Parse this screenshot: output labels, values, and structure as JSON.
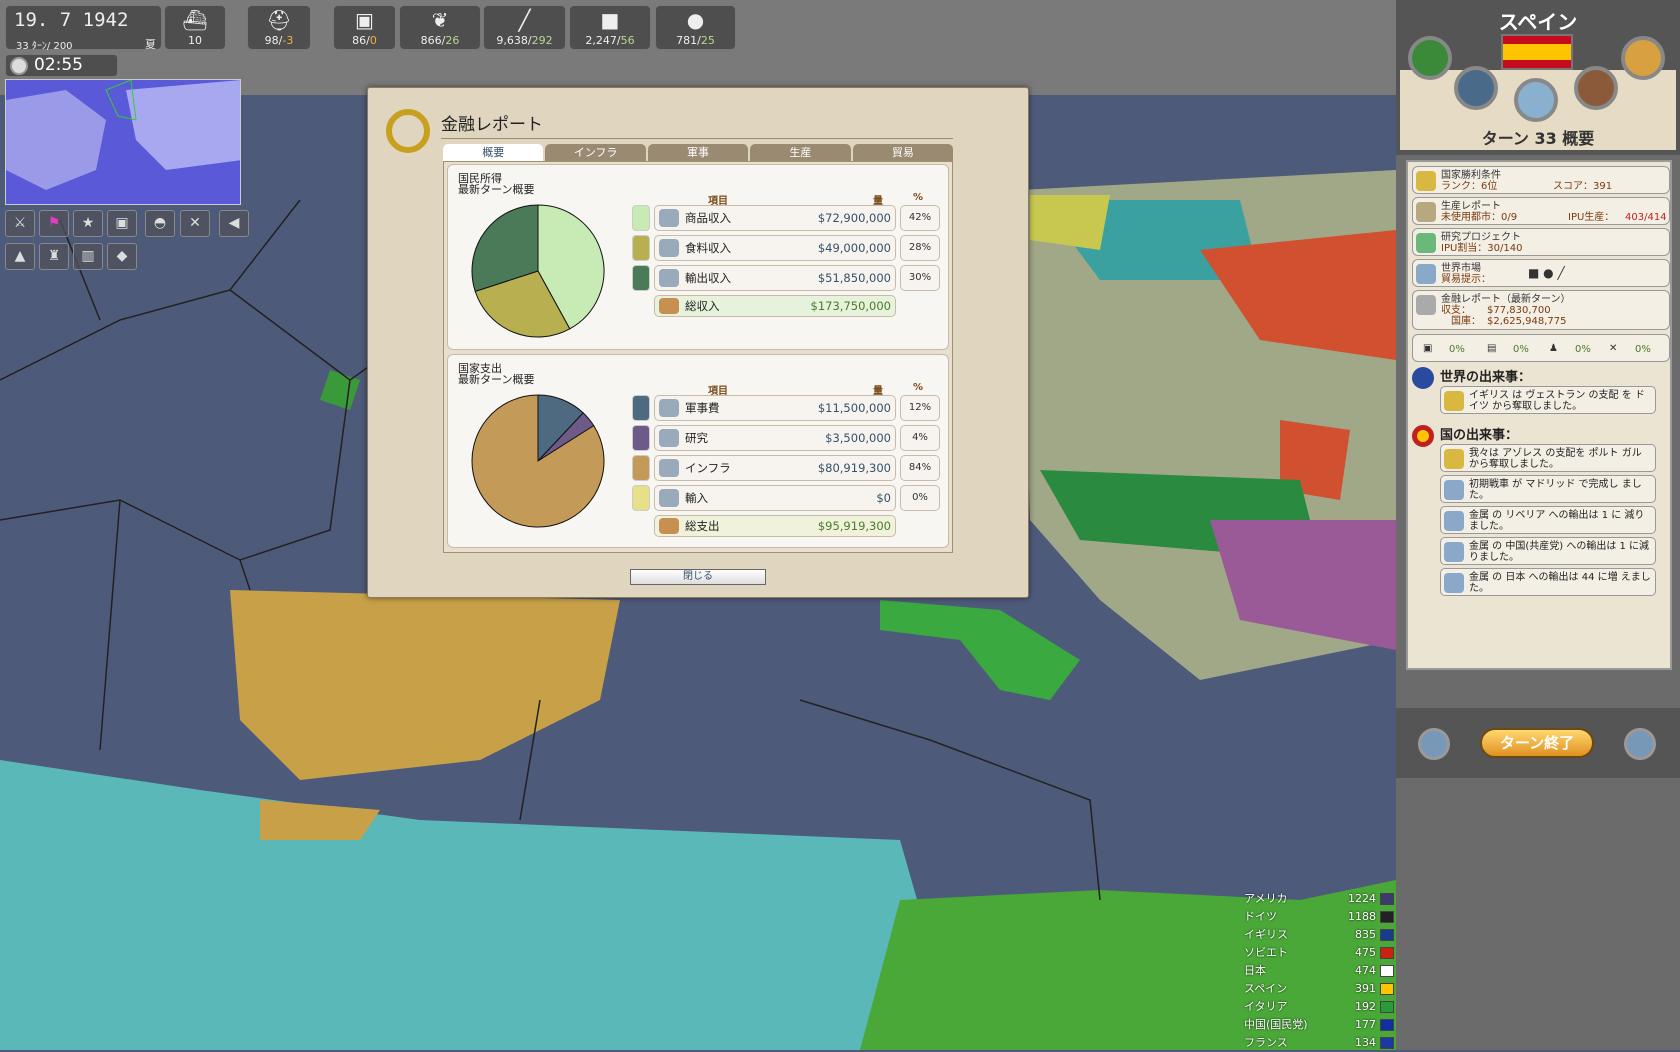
{
  "topbar": {
    "date": "19. 7 1942",
    "turns": "33 ﾀｰﾝ/ 200",
    "season": "夏",
    "clock": "02:55",
    "resources": [
      {
        "name": "ships",
        "icon": "ship-icon",
        "value": "10",
        "delta": ""
      },
      {
        "name": "manpower",
        "icon": "soldier-icon",
        "value": "98/",
        "delta": "-3",
        "sign": "neg"
      },
      {
        "name": "goods",
        "icon": "toaster-icon",
        "value": "86/",
        "delta": "0",
        "sign": "neg"
      },
      {
        "name": "food",
        "icon": "wheat-icon",
        "value": "866/",
        "delta": "26",
        "sign": "pos"
      },
      {
        "name": "metal",
        "icon": "steel-beam-icon",
        "value": "9,638/",
        "delta": "292",
        "sign": "pos"
      },
      {
        "name": "coal",
        "icon": "ore-cart-icon",
        "value": "2,247/",
        "delta": "56",
        "sign": "pos"
      },
      {
        "name": "oil",
        "icon": "oil-drop-icon",
        "value": "781/",
        "delta": "25",
        "sign": "pos"
      }
    ]
  },
  "dialog": {
    "title": "金融レポート",
    "close": "閉じる",
    "tabs": [
      "概要",
      "インフラ",
      "軍事",
      "生産",
      "貿易"
    ],
    "income": {
      "h1": "国民所得",
      "h2": "最新ターン概要",
      "col_item": "項目",
      "col_amount": "量",
      "col_pct": "%",
      "rows": [
        {
          "label": "商品収入",
          "amount": "$72,900,000",
          "pct": "42%",
          "color": "#c8eab4",
          "value": 42
        },
        {
          "label": "食料収入",
          "amount": "$49,000,000",
          "pct": "28%",
          "color": "#b8b050",
          "value": 28
        },
        {
          "label": "輸出収入",
          "amount": "$51,850,000",
          "pct": "30%",
          "color": "#4a7a58",
          "value": 30
        }
      ],
      "total_label": "総収入",
      "total": "$173,750,000"
    },
    "expense": {
      "h1": "国家支出",
      "h2": "最新ターン概要",
      "col_item": "項目",
      "col_amount": "量",
      "col_pct": "%",
      "rows": [
        {
          "label": "軍事費",
          "amount": "$11,500,000",
          "pct": "12%",
          "color": "#4e6a80",
          "value": 12
        },
        {
          "label": "研究",
          "amount": "$3,500,000",
          "pct": "4%",
          "color": "#6e5a88",
          "value": 4
        },
        {
          "label": "インフラ",
          "amount": "$80,919,300",
          "pct": "84%",
          "color": "#c49a58",
          "value": 84
        },
        {
          "label": "輸入",
          "amount": "$0",
          "pct": "0%",
          "color": "#e8e088",
          "value": 0
        }
      ],
      "total_label": "総支出",
      "total": "$95,919,300"
    }
  },
  "panel": {
    "country": "スペイン",
    "turn_title": "ターン 33 概要",
    "victory": {
      "t1": "国家勝利条件",
      "rank": "ランク：6位",
      "score": "スコア：391"
    },
    "production": {
      "t1": "生産レポート",
      "t2": "未使用都市：0/9",
      "ipu_label": "IPU生産：",
      "ipu": "403/414"
    },
    "research": {
      "t1": "研究プロジェクト",
      "t2": "IPU割当：30/140"
    },
    "market": {
      "t1": "世界市場",
      "t2": "貿易提示："
    },
    "finance": {
      "t1": "金融レポート（最新ターン）",
      "bal_label": "収支：",
      "bal": "$77,830,700",
      "tre_label": "国庫：",
      "tre": "$2,625,948,775"
    },
    "pcts": [
      "0%",
      "0%",
      "0%",
      "0%"
    ],
    "world_events_title": "世界の出来事：",
    "world_events": [
      "イギリス は ヴェストラン の支配 を ドイツ から奪取しました。"
    ],
    "nation_events_title": "国の出来事：",
    "nation_events": [
      "我々は アゾレス の支配を ポルト ガル から奪取しました。",
      "初期戦車 が マドリッド で完成し ました。",
      "金属 の リベリア への輸出は 1 に 減りました。",
      "金属 の 中国(共産党) への輸出は 1 に減りました。",
      "金属 の 日本 への輸出は 44 に増 えました。"
    ],
    "end_turn": "ターン終了"
  },
  "rankings": [
    {
      "name": "アメリカ",
      "score": "1224",
      "flag": "#3c3b6e"
    },
    {
      "name": "ドイツ",
      "score": "1188",
      "flag": "#222"
    },
    {
      "name": "イギリス",
      "score": "835",
      "flag": "#1a3a8a"
    },
    {
      "name": "ソビエト",
      "score": "475",
      "flag": "#cc2010"
    },
    {
      "name": "日本",
      "score": "474",
      "flag": "#fff"
    },
    {
      "name": "スペイン",
      "score": "391",
      "flag": "#ffc400"
    },
    {
      "name": "イタリア",
      "score": "192",
      "flag": "#2a9a3a"
    },
    {
      "name": "中国(国民党)",
      "score": "177",
      "flag": "#1030a0"
    },
    {
      "name": "フランス",
      "score": "134",
      "flag": "#1a3aa0"
    }
  ]
}
